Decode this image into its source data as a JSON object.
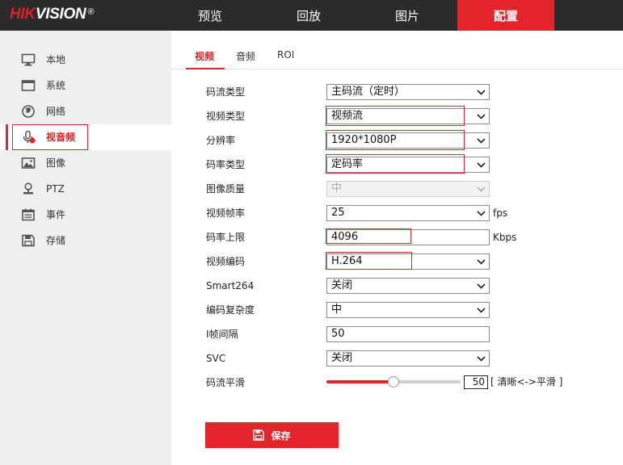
{
  "header": {
    "logo_main": "HIKVISION",
    "logo_mark": "®",
    "nav": [
      {
        "label": "预览",
        "active": false
      },
      {
        "label": "回放",
        "active": false
      },
      {
        "label": "图片",
        "active": false
      },
      {
        "label": "配置",
        "active": true
      }
    ]
  },
  "sidebar": {
    "items": [
      {
        "label": "本地",
        "icon": "monitor-icon",
        "active": false
      },
      {
        "label": "系统",
        "icon": "window-icon",
        "active": false
      },
      {
        "label": "网络",
        "icon": "globe-icon",
        "active": false
      },
      {
        "label": "视音频",
        "icon": "microphone-icon",
        "active": true
      },
      {
        "label": "图像",
        "icon": "image-icon",
        "active": false
      },
      {
        "label": "PTZ",
        "icon": "ptz-icon",
        "active": false
      },
      {
        "label": "事件",
        "icon": "calendar-icon",
        "active": false
      },
      {
        "label": "存储",
        "icon": "floppy-disk-icon",
        "active": false
      }
    ]
  },
  "tabs": [
    {
      "label": "视频",
      "active": true
    },
    {
      "label": "音频",
      "active": false
    },
    {
      "label": "ROI",
      "active": false
    }
  ],
  "form": {
    "stream_type": {
      "label": "码流类型",
      "value": "主码流（定时）"
    },
    "video_type": {
      "label": "视频类型",
      "value": "视频流"
    },
    "resolution": {
      "label": "分辨率",
      "value": "1920*1080P"
    },
    "bitrate_type": {
      "label": "码率类型",
      "value": "定码率"
    },
    "image_quality": {
      "label": "图像质量",
      "value": "中",
      "disabled": true
    },
    "frame_rate": {
      "label": "视频帧率",
      "value": "25",
      "unit": "fps"
    },
    "max_bitrate": {
      "label": "码率上限",
      "value": "4096",
      "unit": "Kbps"
    },
    "video_encoding": {
      "label": "视频编码",
      "value": "H.264"
    },
    "smart264": {
      "label": "Smart264",
      "value": "关闭"
    },
    "encoding_complexity": {
      "label": "编码复杂度",
      "value": "中"
    },
    "i_frame_interval": {
      "label": "I帧间隔",
      "value": "50"
    },
    "svc": {
      "label": "SVC",
      "value": "关闭"
    },
    "stream_smoothing": {
      "label": "码流平滑",
      "value": "50",
      "level_percent": 50,
      "hint": "[ 清晰<->平滑 ]"
    }
  },
  "save_label": "保存",
  "colors": {
    "accent": "#e3242b",
    "topbar": "#2b2b2b",
    "sidebar": "#efefef"
  }
}
